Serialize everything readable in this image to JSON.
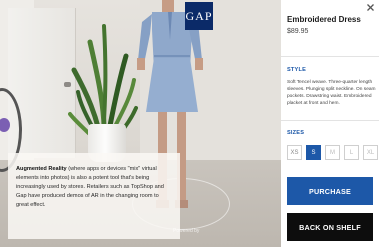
{
  "scene": {
    "brand_logo": "GAP",
    "caption": {
      "term": "Augmented Reality",
      "body": " (where apps or devices \"mix\" virtual elements into photos) is also a potent tool that's being increasingly used by stores. Retailers such as TopShop and Gap have produced demos of AR in the changing room to great effect."
    },
    "watermark": "Powered by"
  },
  "product": {
    "name": "Embroidered Dress",
    "price": "$89.95",
    "style_label": "STYLE",
    "style_description": "Soft Tencel weave. Three-quarter length sleeves. Plunging split neckline. On seam pockets. Drawstring waist. Embroidered placket at front and hem.",
    "sizes_label": "SIZES",
    "sizes": [
      "XS",
      "S",
      "M",
      "L",
      "XL"
    ],
    "selected_size": "S",
    "purchase_label": "PURCHASE",
    "back_label": "BACK ON SHELF"
  },
  "colors": {
    "accent": "#1d58a8",
    "back_button": "#0d0d0d",
    "logo_bg": "#0b2a68"
  },
  "icons": [
    "close-icon"
  ]
}
